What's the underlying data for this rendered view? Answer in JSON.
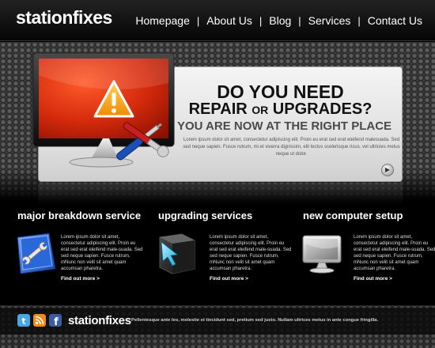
{
  "header": {
    "logo": "stationfixes",
    "nav": [
      {
        "label": "Homepage"
      },
      {
        "label": "About Us"
      },
      {
        "label": "Blog"
      },
      {
        "label": "Services"
      },
      {
        "label": "Contact Us"
      }
    ],
    "separator": "|"
  },
  "hero": {
    "heading_line1": "DO YOU NEED",
    "heading_line2_a": "REPAIR ",
    "heading_line2_b": "OR",
    "heading_line2_c": " UPGRADES?",
    "heading_line3": "YOU ARE NOW AT THE RIGHT PLACE",
    "body": "Lorem ipsum dolor sit amet, consectetur adipiscing elit. Proin eu erat sed erat eleifend malesuada. Sed sed neque sapien. Fusce rutrum, mi et viverra dignissim, elit lectus scelerisque risus, vel ultricies metus neque ut dolor.",
    "next_icon": "arrow-right-icon"
  },
  "features": [
    {
      "title": "major breakdown service",
      "icon": "wrench-icon",
      "text": "Lorem ipsum dolor sit amet, consectetur adipiscing elit. Proin eu erat sed erat eleifend male-suada. Sed sed neque sapien. Fusce rutrum, mNunc non velit sit amet quam accumsan pharetra.",
      "more": "Find out more >"
    },
    {
      "title": "upgrading services",
      "icon": "cursor-cube-icon",
      "text": "Lorem ipsum dolor sit amet, consectetur adipiscing elit. Proin eu erat sed erat eleifend male-suada. Sed sed neque sapien. Fusce rutrum, mNunc non velit sit amet quam accumsan pharetra.",
      "more": "Find out more >"
    },
    {
      "title": "new computer setup",
      "icon": "monitor-icon",
      "text": "Lorem ipsum dolor sit amet, consectetur adipiscing elit. Proin eu erat sed erat eleifend male-suada. Sed sed neque sapien. Fusce rutrum, mNunc non velit sit amet quam accumsan pharetra.",
      "more": "Find out more >"
    }
  ],
  "footer": {
    "logo": "stationfixes",
    "text": "Pellentesque ante leo, molestie et tincidunt sed, pretium sed justo. Nullam ultrices metus in ante congue fringilla.",
    "social": [
      {
        "icon": "twitter-icon",
        "color": "#4aa6de"
      },
      {
        "icon": "rss-icon",
        "color": "#f08a1c"
      },
      {
        "icon": "facebook-icon",
        "color": "#3b5da0"
      }
    ]
  },
  "colors": {
    "screen_red": "#d42a0c",
    "warning_orange": "#f5a623",
    "feature_blue": "#1f5fc4"
  }
}
